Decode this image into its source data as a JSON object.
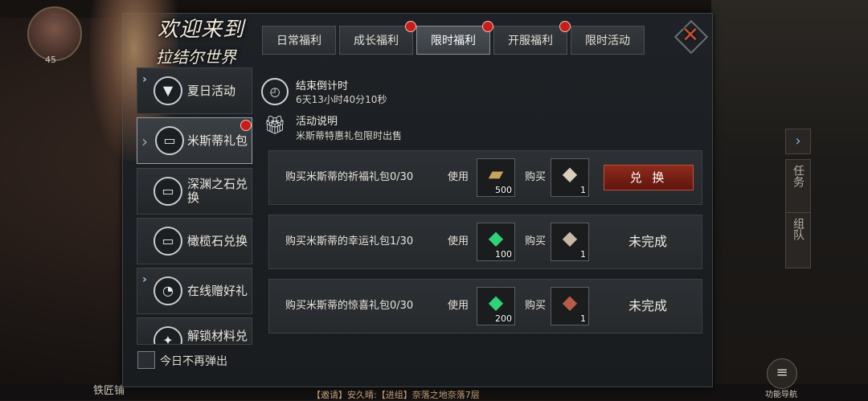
{
  "hud": {
    "level": "45",
    "smith_label": "铁匠铺",
    "side_tab_task": "任务",
    "side_tab_team": "组队",
    "nav_label": "功能导航",
    "chat_line": "【邀请】安久晴:【进组】奈落之地奈落7层"
  },
  "banner": {
    "line1": "欢迎来到",
    "line2": "拉结尔世界"
  },
  "tabs": [
    {
      "label": "日常福利",
      "active": false,
      "badge": false
    },
    {
      "label": "成长福利",
      "active": false,
      "badge": true
    },
    {
      "label": "限时福利",
      "active": true,
      "badge": true
    },
    {
      "label": "开服福利",
      "active": false,
      "badge": true
    },
    {
      "label": "限时活动",
      "active": false,
      "badge": false
    }
  ],
  "menu": [
    {
      "label": "夏日活动",
      "icon": "diamond-icon",
      "expandable": true,
      "active": false,
      "badge": false
    },
    {
      "label": "米斯蒂礼包",
      "icon": "package-icon",
      "expandable": false,
      "active": true,
      "badge": true
    },
    {
      "label": "深渊之石兑换",
      "icon": "package-icon",
      "expandable": false,
      "active": false,
      "badge": false
    },
    {
      "label": "橄榄石兑换",
      "icon": "package-icon",
      "expandable": false,
      "active": false,
      "badge": false
    },
    {
      "label": "在线赠好礼",
      "icon": "timer-icon",
      "expandable": true,
      "active": false,
      "badge": false
    },
    {
      "label": "解锁材料兑",
      "icon": "wings-icon",
      "expandable": false,
      "active": false,
      "badge": false
    }
  ],
  "dont_show_today": "今日不再弹出",
  "countdown": {
    "title": "结束倒计时",
    "value": "6天13小时40分10秒"
  },
  "description": {
    "title": "活动说明",
    "text": "米斯蒂特惠礼包限时出售"
  },
  "rows": [
    {
      "label": "购买米斯蒂的祈福礼包0/30",
      "use_label": "使用",
      "use_item": {
        "icon": "ticket-icon",
        "count": "500"
      },
      "buy_label": "购买",
      "buy_item": {
        "icon": "bag-icon",
        "count": "1"
      },
      "action": {
        "type": "button",
        "label": "兑 换"
      }
    },
    {
      "label": "购买米斯蒂的幸运礼包1/30",
      "use_label": "使用",
      "use_item": {
        "icon": "emerald-icon",
        "count": "100"
      },
      "buy_label": "购买",
      "buy_item": {
        "icon": "bag-icon",
        "count": "1"
      },
      "action": {
        "type": "status",
        "label": "未完成"
      }
    },
    {
      "label": "购买米斯蒂的惊喜礼包0/30",
      "use_label": "使用",
      "use_item": {
        "icon": "emerald-icon",
        "count": "200"
      },
      "buy_label": "购买",
      "buy_item": {
        "icon": "bag-icon",
        "count": "1"
      },
      "action": {
        "type": "status",
        "label": "未完成"
      }
    }
  ]
}
